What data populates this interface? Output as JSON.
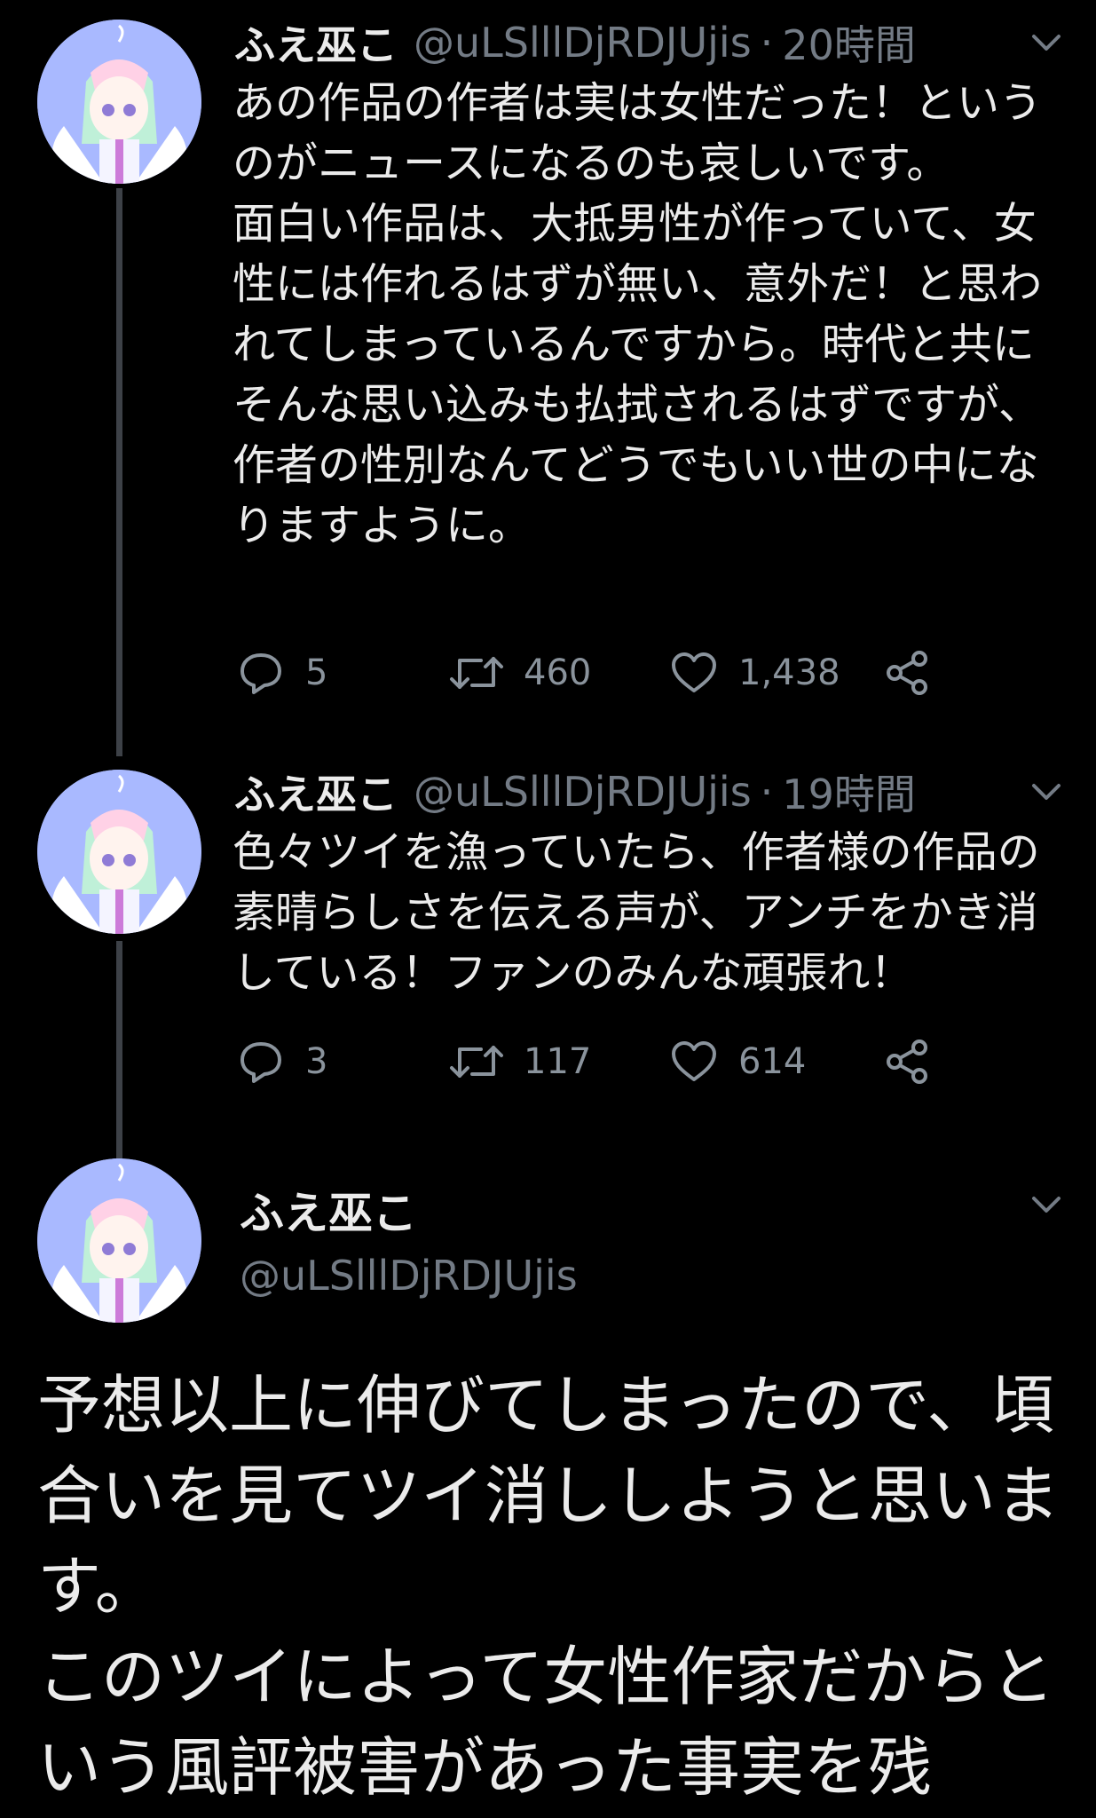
{
  "colors": {
    "background": "#000000",
    "text": "#ebebeb",
    "secondary": "#737b85",
    "thread_line": "#3d4147",
    "avatar_bg": "#a9b9ff"
  },
  "tweets": [
    {
      "name": "ふえ巫こ",
      "handle": "@uLSlllDjRDJUjis",
      "separator": "·",
      "time": "20時間",
      "text": "あの作品の作者は実は女性だった！というのがニュースになるのも哀しいです。\n面白い作品は、大抵男性が作っていて、女性には作れるはずが無い、意外だ！と思われてしまっているんですから。時代と共にそんな思い込みも払拭されるはずですが、\n作者の性別なんてどうでもいい世の中になりますように。",
      "replies": "5",
      "retweets": "460",
      "likes": "1,438"
    },
    {
      "name": "ふえ巫こ",
      "handle": "@uLSlllDjRDJUjis",
      "separator": "·",
      "time": "19時間",
      "text": "色々ツイを漁っていたら、作者様の作品の素晴らしさを伝える声が、アンチをかき消している！ファンのみんな頑張れ！",
      "replies": "3",
      "retweets": "117",
      "likes": "614"
    }
  ],
  "focused_tweet": {
    "name": "ふえ巫こ",
    "handle": "@uLSlllDjRDJUjis",
    "text": "予想以上に伸びてしまったので、頃合いを見てツイ消ししようと思います。\nこのツイによって女性作家だからという風評被害があった事実を残"
  },
  "icons": {
    "reply": "reply-icon",
    "retweet": "retweet-icon",
    "like": "heart-icon",
    "share": "share-icon",
    "menu": "chevron-down-icon",
    "avatar": "avatar-angel-illustration"
  }
}
